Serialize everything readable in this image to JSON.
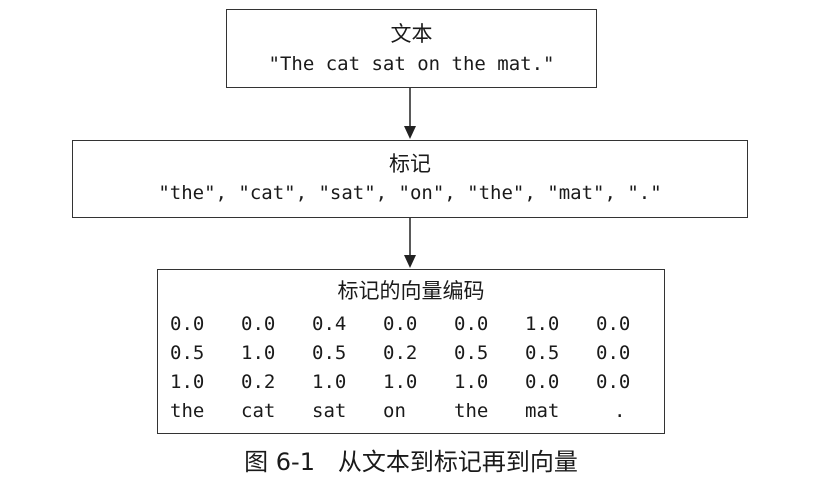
{
  "text_box": {
    "title": "文本",
    "content": "\"The cat sat on the mat.\""
  },
  "tokens_box": {
    "title": "标记",
    "content": "\"the\", \"cat\", \"sat\", \"on\", \"the\", \"mat\", \".\""
  },
  "vectors_box": {
    "title": "标记的向量编码",
    "rows": [
      [
        "0.0",
        "0.0",
        "0.4",
        "0.0",
        "0.0",
        "1.0",
        "0.0"
      ],
      [
        "0.5",
        "1.0",
        "0.5",
        "0.2",
        "0.5",
        "0.5",
        "0.0"
      ],
      [
        "1.0",
        "0.2",
        "1.0",
        "1.0",
        "1.0",
        "0.0",
        "0.0"
      ]
    ],
    "tokens": [
      "the",
      "cat",
      "sat",
      "on",
      "the",
      "mat",
      "."
    ]
  },
  "caption": "图 6-1   从文本到标记再到向量"
}
